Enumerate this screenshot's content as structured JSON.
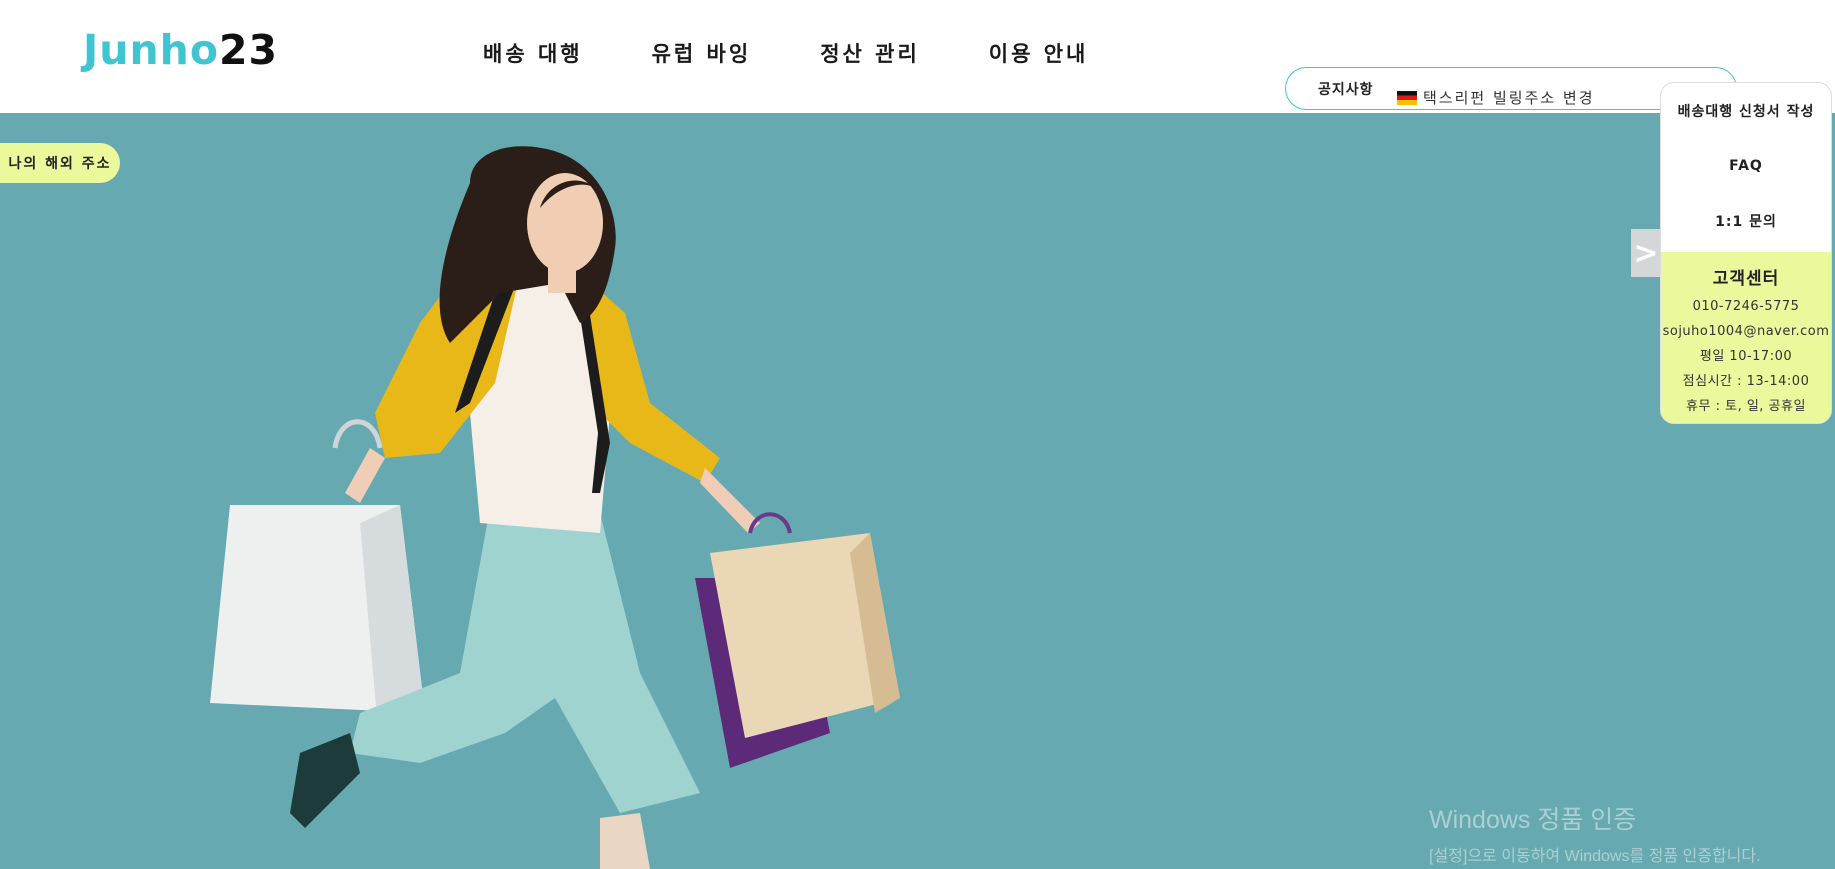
{
  "header": {
    "logo_accent": "Junho",
    "logo_dark": "23",
    "nav": [
      "배송 대행",
      "유럽 바잉",
      "정산 관리",
      "이용 안내"
    ]
  },
  "notice": {
    "label": "공지사항",
    "text": "택스리펀 빌링주소 변경"
  },
  "floating": {
    "my_address": "나의 해외 주소",
    "arrow": ">"
  },
  "side_panel": {
    "links": [
      "배송대행 신청서 작성",
      "FAQ",
      "1:1 문의"
    ],
    "cs": {
      "title": "고객센터",
      "phone": "010-7246-5775",
      "email": "sojuho1004@naver.com",
      "weekday": "평일 10-17:00",
      "lunch": "점심시간 : 13-14:00",
      "closed": "휴무 : 토, 일, 공휴일"
    }
  },
  "watermark": {
    "line1": "Windows 정품 인증",
    "line2": "[설정]으로 이동하여 Windows를 정품 인증합니다."
  },
  "colors": {
    "accent": "#3ec5d1",
    "hero_bg": "#66a9b1",
    "highlight": "#ecf89c"
  }
}
